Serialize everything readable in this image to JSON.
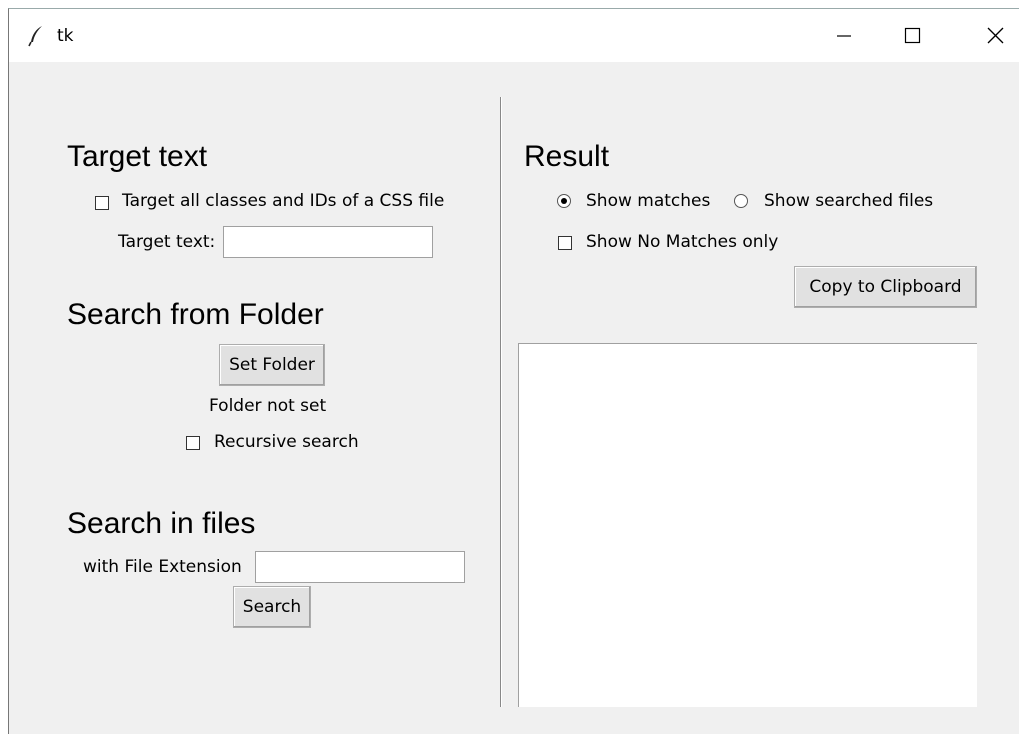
{
  "window": {
    "title": "tk",
    "icon": "feather-icon",
    "controls": {
      "minimize": "minimize-icon",
      "maximize": "maximize-icon",
      "close": "close-icon"
    }
  },
  "left": {
    "target": {
      "heading": "Target text",
      "css_checkbox_label": "Target all classes and IDs of a CSS file",
      "css_checkbox_checked": false,
      "target_label": "Target text:",
      "target_value": ""
    },
    "folder": {
      "heading": "Search from Folder",
      "set_folder_button": "Set Folder",
      "status": "Folder not set",
      "recursive_label": "Recursive search",
      "recursive_checked": false
    },
    "files": {
      "heading": "Search in files",
      "extension_label": "with File Extension",
      "extension_value": "",
      "search_button": "Search"
    }
  },
  "right": {
    "heading": "Result",
    "radio_show_matches": "Show matches",
    "radio_show_searched": "Show searched files",
    "selected_radio": "Show matches",
    "no_matches_label": "Show No Matches only",
    "no_matches_checked": false,
    "copy_button": "Copy to Clipboard",
    "result_text": ""
  }
}
